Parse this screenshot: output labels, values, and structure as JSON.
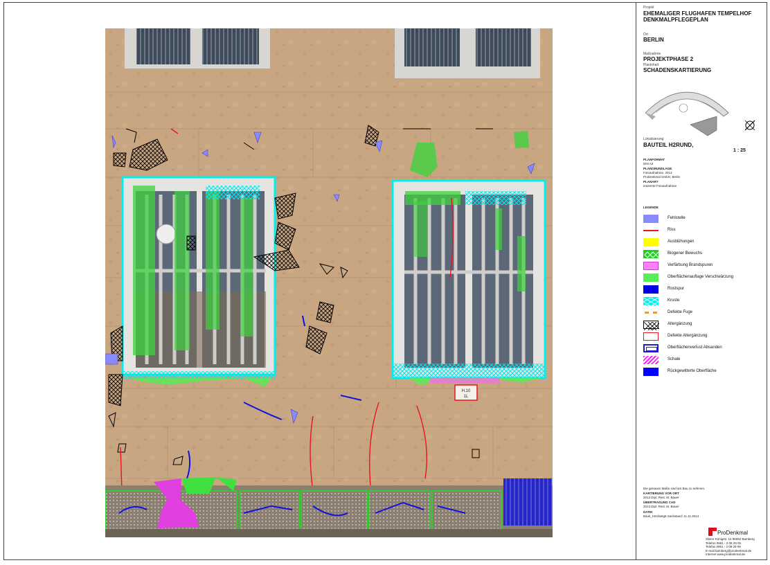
{
  "titleblock": {
    "projekt_label": "Projekt",
    "projekt_value": "EHEMALIGER FLUGHAFEN TEMPELHOF DENKMALPFLEGEPLAN",
    "ort_label": "Ort",
    "ort_value": "BERLIN",
    "massnahme_label": "Maßnahme",
    "massnahme_value": "PROJEKTPHASE 2",
    "planinhalt_label": "Planinhalt",
    "planinhalt_value": "SCHADENSKARTIERUNG",
    "lokalisierung_label": "Lokalisierung",
    "lokalisierung_value": "BAUTEIL H2RUND,",
    "scale": "1 : 25",
    "planformat_label": "PLANFORMAT",
    "planformat_value": "DIN A2",
    "plangrundlage_label": "PLANGRUNDLAGE",
    "plangrundlage_value1": "Fotoaufnahme, 2013",
    "plangrundlage_value2": "ProDenkmal GmbH, Berlin",
    "planart_label": "PLANART",
    "planart_value": "entzerrte Fotoaufnahme",
    "legende_label": "LEGENDE",
    "legend": [
      {
        "text": "Fehlstelle",
        "color": "#8a8aff"
      },
      {
        "text": "Riss",
        "color": "#e8141e"
      },
      {
        "text": "Ausblühungen",
        "color": "#ffff00"
      },
      {
        "text": "Biogener Bewuchs",
        "color": "#20d020"
      },
      {
        "text": "Verfärbung Brandspuren",
        "color": "#ff80ff"
      },
      {
        "text": "Oberflächenauflage Verschwärzung",
        "color": "#55ee55"
      },
      {
        "text": "Rostspur",
        "color": "#0000e8"
      },
      {
        "text": "Kruste",
        "color": "#00f0f0"
      },
      {
        "text": "Defekte Fuge",
        "color": "#e0a040"
      },
      {
        "text": "Altergänzung",
        "color": "#000000"
      },
      {
        "text": "Defekte Altergänzung",
        "color": "#e8141e"
      },
      {
        "text": "Oberflächenverlust Absanden",
        "color": "#2020c0"
      },
      {
        "text": "Schale",
        "color": "#ff20ff"
      },
      {
        "text": "Rückgewitterte Oberfläche",
        "color": "#0000ff"
      }
    ],
    "footnote": "Die genauen Maße sind am Bau zu nehmen.",
    "kartierung_label": "KARTIERUNG VOR ORT",
    "kartierung_value": "2013    Dipl. Rest. M. Bauer",
    "uebertragung_label": "ÜBERTRAGUNG CAD",
    "uebertragung_value": "2013    Dipl. Rest. M. Bauer",
    "datei_label": "DATEI",
    "datei_value": "Bauk_H2rdsetg6 Sackstand: 11.11.2014",
    "company": "ProDenkmal",
    "address": [
      "Obere Königstr. 15    96052 Bamberg",
      "Telefon          0951 - 2 08 29 05",
      "Telefax          0951 - 2 08 29 09",
      "E-mail     bamberg@prodenkmal.de",
      "Internet     www.prodenkmal.de"
    ]
  },
  "drawing": {
    "plaque_line1": "H.10",
    "plaque_line2": "1L"
  },
  "colors": {
    "wall": "#c7a47f",
    "frame": "#e8e6e2",
    "glass": "#5a6a7a"
  }
}
